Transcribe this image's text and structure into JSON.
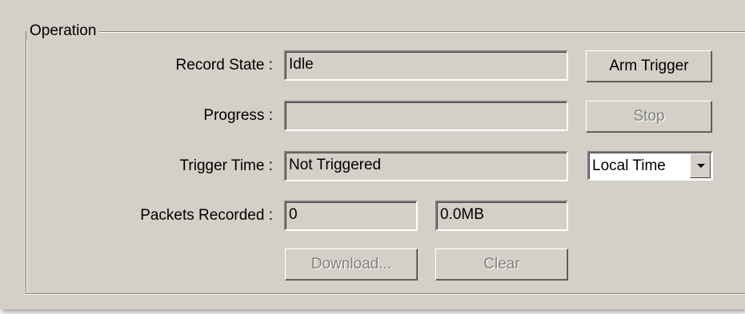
{
  "group": {
    "title": "Operation"
  },
  "record_state": {
    "label": "Record State :",
    "value": "Idle"
  },
  "progress": {
    "label": "Progress :",
    "value": 0
  },
  "trigger_time": {
    "label": "Trigger Time :",
    "value": "Not Triggered"
  },
  "packets": {
    "label": "Packets Recorded :",
    "count": "0",
    "size": "0.0MB"
  },
  "buttons": {
    "arm_trigger": "Arm Trigger",
    "stop": "Stop",
    "download": "Download...",
    "clear": "Clear"
  },
  "time_mode": {
    "selected": "Local Time"
  },
  "icons": {
    "dropdown": "chevron-down-icon"
  }
}
